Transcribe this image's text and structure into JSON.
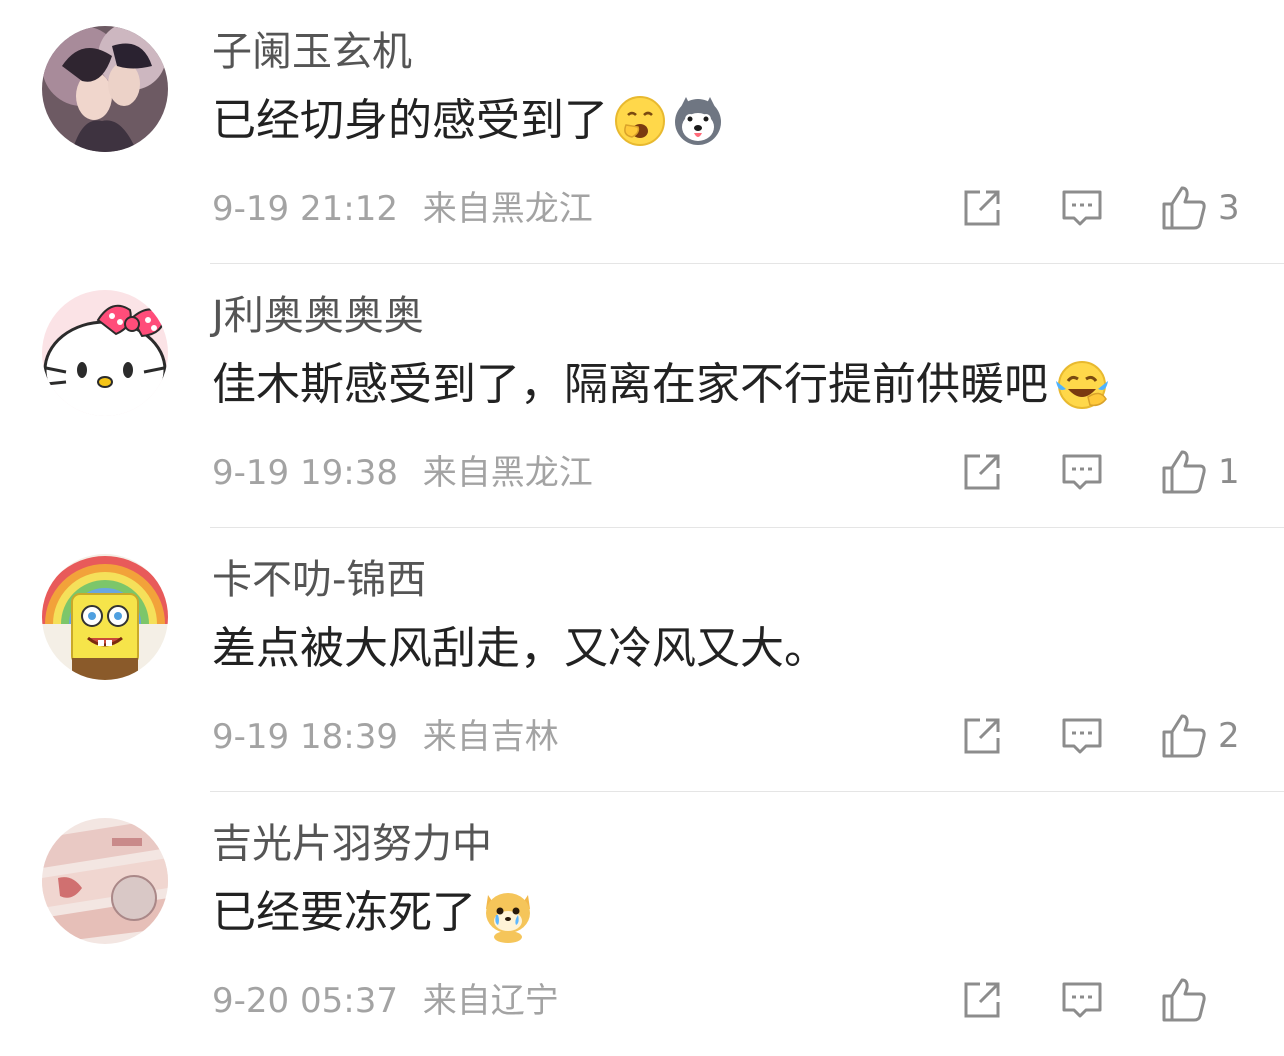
{
  "comments": [
    {
      "username": "子阑玉玄机",
      "text": "已经切身的感受到了",
      "emojis": [
        "yawn-emoji",
        "husky-emoji"
      ],
      "date": "9-19 21:12",
      "location": "来自黑龙江",
      "likes": "3"
    },
    {
      "username": "J利奥奥奥奥",
      "text": "佳木斯感受到了，隔离在家不行提前供暖吧",
      "emojis": [
        "laugh-cry-emoji"
      ],
      "date": "9-19 19:38",
      "location": "来自黑龙江",
      "likes": "1"
    },
    {
      "username": "卡不叻-锦西",
      "text": "差点被大风刮走，又冷风又大。",
      "emojis": [],
      "date": "9-19 18:39",
      "location": "来自吉林",
      "likes": "2"
    },
    {
      "username": "吉光片羽努力中",
      "text": "已经要冻死了",
      "emojis": [
        "crying-dog-emoji"
      ],
      "date": "9-20 05:37",
      "location": "来自辽宁",
      "likes": ""
    }
  ],
  "colors": {
    "username": "#555555",
    "text": "#222222",
    "meta": "#a3a3a3",
    "icon": "#8c8c8c"
  }
}
